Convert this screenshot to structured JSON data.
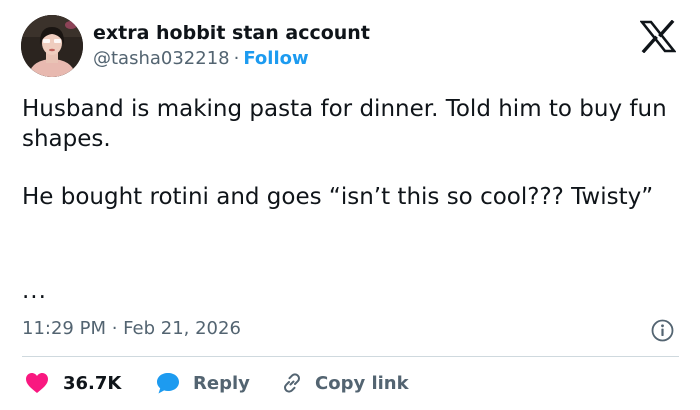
{
  "author": {
    "display_name": "extra hobbit stan account",
    "handle": "@tasha032218",
    "separator": "·",
    "follow_label": "Follow"
  },
  "brand": {
    "logo_icon": "x-logo-icon"
  },
  "tweet": {
    "paragraph_1": "Husband is making pasta for dinner. Told him to buy fun shapes.",
    "paragraph_2": "He bought rotini and goes “isn’t this so cool??? Twisty”",
    "ellipsis": "...",
    "timestamp": "11:29 PM · Feb 21, 2026"
  },
  "actions": {
    "like_count": "36.7K",
    "reply_label": "Reply",
    "copy_link_label": "Copy link"
  },
  "colors": {
    "text": "#0f1419",
    "secondary": "#536471",
    "accent": "#1d9bf0",
    "like": "#f91880",
    "divider": "#cfd9de"
  }
}
